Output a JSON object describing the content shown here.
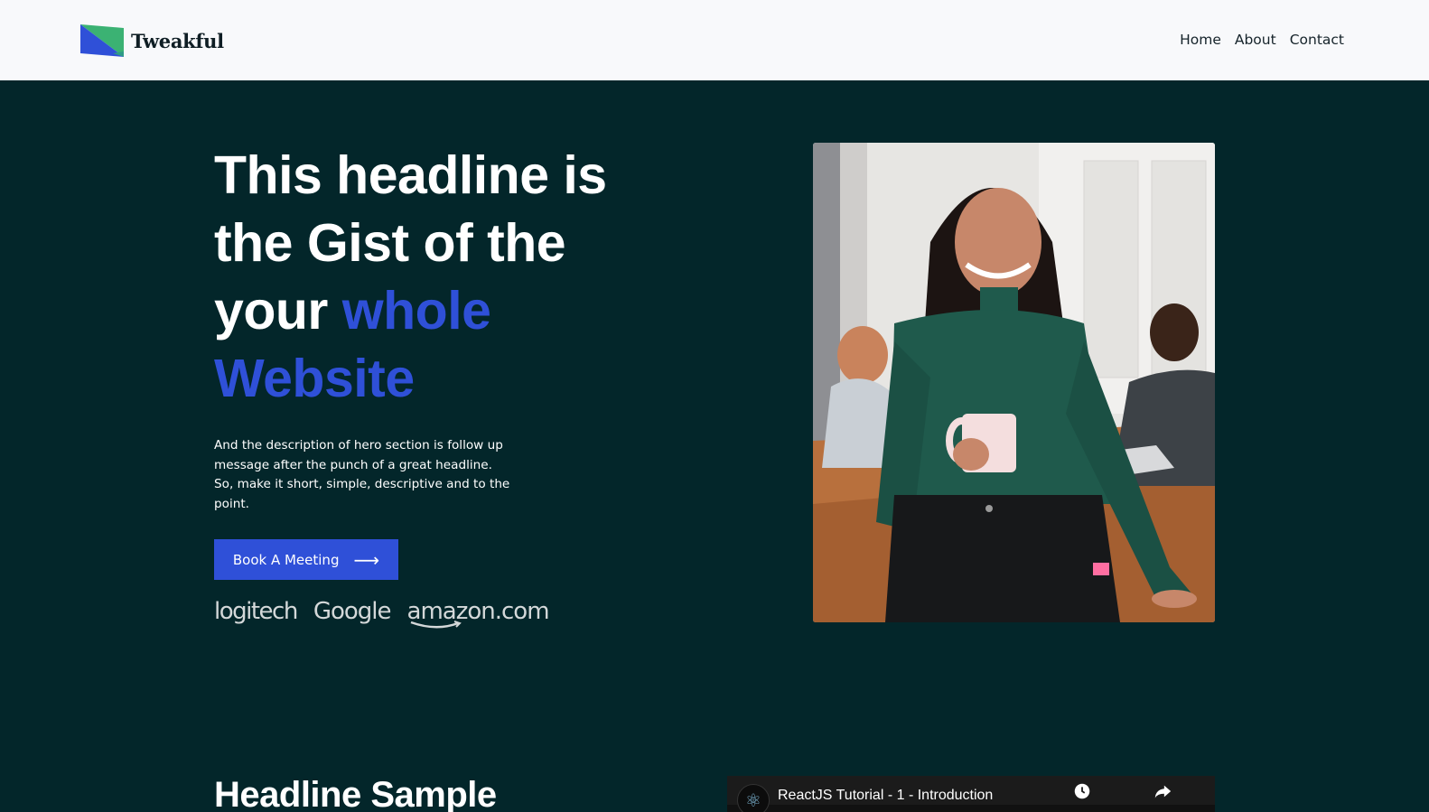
{
  "header": {
    "brand": "Tweakful",
    "nav": [
      "Home",
      "About",
      "Contact"
    ]
  },
  "hero": {
    "title_part1": "This headline is the Gist of the your ",
    "title_accent": "whole Website",
    "description": "And the description of hero section is follow up message after the punch of a great headline. So, make it short, simple, descriptive and to the point.",
    "cta_label": "Book A Meeting",
    "cta_icon": "arrow-right-icon",
    "partner_logos": [
      "logitech",
      "Google",
      "amazon.com"
    ]
  },
  "section2": {
    "title": "Headline Sample",
    "video": {
      "title": "ReactJS Tutorial - 1 - Introduction",
      "icons": [
        "channel-avatar-icon",
        "watch-later-icon",
        "share-icon"
      ]
    }
  },
  "colors": {
    "background": "#03262a",
    "header_bg": "#f8f9fb",
    "accent": "#2f50d8",
    "logo_green": "#3bb273"
  }
}
